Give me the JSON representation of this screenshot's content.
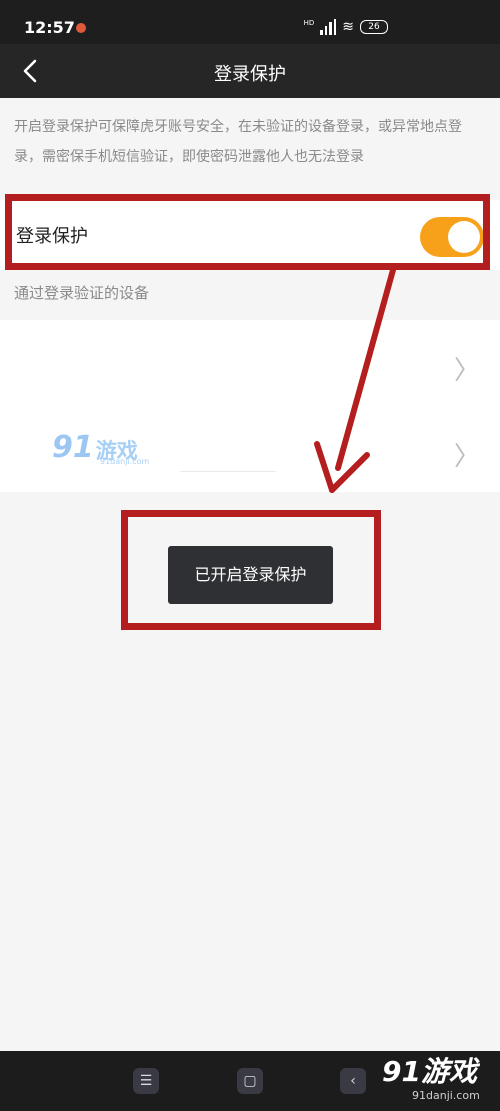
{
  "status_bar": {
    "time": "12:57",
    "network": "HD",
    "battery": "26"
  },
  "nav": {
    "title": "登录保护"
  },
  "description": "开启登录保护可保障虎牙账号安全，在未验证的设备登录，或异常地点登录，需密保手机短信验证，即使密码泄露他人也无法登录",
  "login_protection": {
    "label": "登录保护",
    "enabled": true,
    "accent_color": "#f7a11a"
  },
  "devices": {
    "header": "通过登录验证的设备",
    "items": [
      {
        "name": ""
      },
      {
        "name": ""
      }
    ]
  },
  "toast": {
    "message": "已开启登录保护"
  },
  "watermark": {
    "number": "91",
    "text": "游戏",
    "sub": "91danji.com"
  },
  "brand_logo": {
    "number": "91",
    "text": "游戏",
    "sub": "91danji.com"
  },
  "annotation_color": "#b41e1e",
  "icons": {
    "back": "chevron-left-icon",
    "chevron": "chevron-right-icon",
    "menu": "menu-icon",
    "home": "home-icon",
    "sys_back": "back-icon"
  }
}
